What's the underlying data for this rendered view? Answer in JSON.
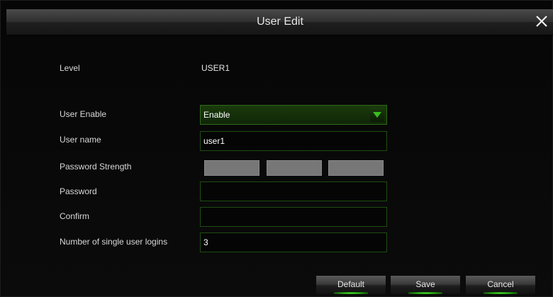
{
  "dialog": {
    "title": "User Edit"
  },
  "form": {
    "level": {
      "label": "Level",
      "value": "USER1"
    },
    "user_enable": {
      "label": "User Enable",
      "value": "Enable"
    },
    "user_name": {
      "label": "User name",
      "value": "user1"
    },
    "password_strength": {
      "label": "Password Strength"
    },
    "password": {
      "label": "Password",
      "value": ""
    },
    "confirm": {
      "label": "Confirm",
      "value": ""
    },
    "single_user_logins": {
      "label": "Number of single user logins",
      "value": "3"
    }
  },
  "buttons": {
    "default": "Default",
    "save": "Save",
    "cancel": "Cancel"
  },
  "colors": {
    "accent_green": "#3dbd1e",
    "field_border": "#1f4d12",
    "strength_block": "#777777"
  },
  "icons": {
    "close": "close-icon",
    "dropdown": "triangle-down-icon"
  }
}
